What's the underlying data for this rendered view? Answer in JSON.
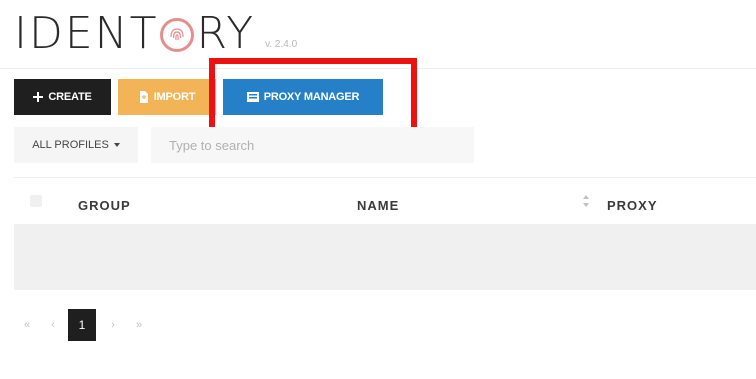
{
  "app": {
    "logo_prefix": "IDENT",
    "logo_suffix": "RY",
    "version": "v. 2.4.0"
  },
  "toolbar": {
    "create_label": "CREATE",
    "import_label": "IMPORT",
    "proxy_manager_label": "PROXY MANAGER"
  },
  "filter": {
    "profiles_label": "ALL PROFILES",
    "search_placeholder": "Type to search"
  },
  "table": {
    "columns": [
      "GROUP",
      "NAME",
      "PROXY"
    ]
  },
  "pagination": {
    "first": "«",
    "prev": "‹",
    "current": "1",
    "next": "›",
    "last": "»"
  },
  "colors": {
    "create": "#1f1f1f",
    "import": "#f2b457",
    "proxy_manager": "#2580c8",
    "highlight": "#ee1111"
  }
}
